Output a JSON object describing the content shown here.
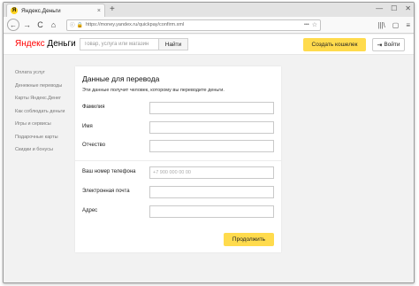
{
  "browser": {
    "tab_title": "Яндекс.Деньги",
    "tab_favicon_letter": "Я",
    "tab_close": "×",
    "new_tab": "+",
    "window_controls": [
      "—",
      "☐",
      "✕"
    ],
    "nav": {
      "back": "←",
      "forward": "→",
      "reload": "C",
      "home": "⌂"
    },
    "url_info": "ⓘ",
    "url_lock": "🔒",
    "url": "https://money.yandex.ru/quickpay/confirm.xml",
    "url_dots": "•••",
    "url_star": "☆",
    "toolbar_icons": [
      "|||\\",
      "▢",
      "≡"
    ]
  },
  "header": {
    "logo_ya": "Яндекс",
    "logo_rest": " Деньги",
    "search_placeholder": "Товар, услуга или магазин",
    "search_button": "Найти",
    "create_wallet": "Создать кошелек",
    "login_icon": "⇥",
    "login": "Войти"
  },
  "sidebar": {
    "items": [
      "Оплата услуг",
      "Денежные переводы",
      "Карты Яндекс.Денег",
      "Как соблюдать деньги",
      "Игры и сервисы",
      "Подарочные карты",
      "Скидки и бонусы"
    ]
  },
  "form": {
    "title": "Данные для перевода",
    "subtitle": "Эти данные получит человек, которому вы переводите деньги.",
    "fields": {
      "last_name": {
        "label": "Фамилия",
        "value": "",
        "placeholder": ""
      },
      "first_name": {
        "label": "Имя",
        "value": "",
        "placeholder": ""
      },
      "patronymic": {
        "label": "Отчество",
        "value": "",
        "placeholder": ""
      },
      "phone": {
        "label": "Ваш номер телефона",
        "value": "",
        "placeholder": "+7 900 000 00 00"
      },
      "email": {
        "label": "Электронная почта",
        "value": "",
        "placeholder": ""
      },
      "address": {
        "label": "Адрес",
        "value": "",
        "placeholder": ""
      }
    },
    "submit": "Продолжить"
  }
}
